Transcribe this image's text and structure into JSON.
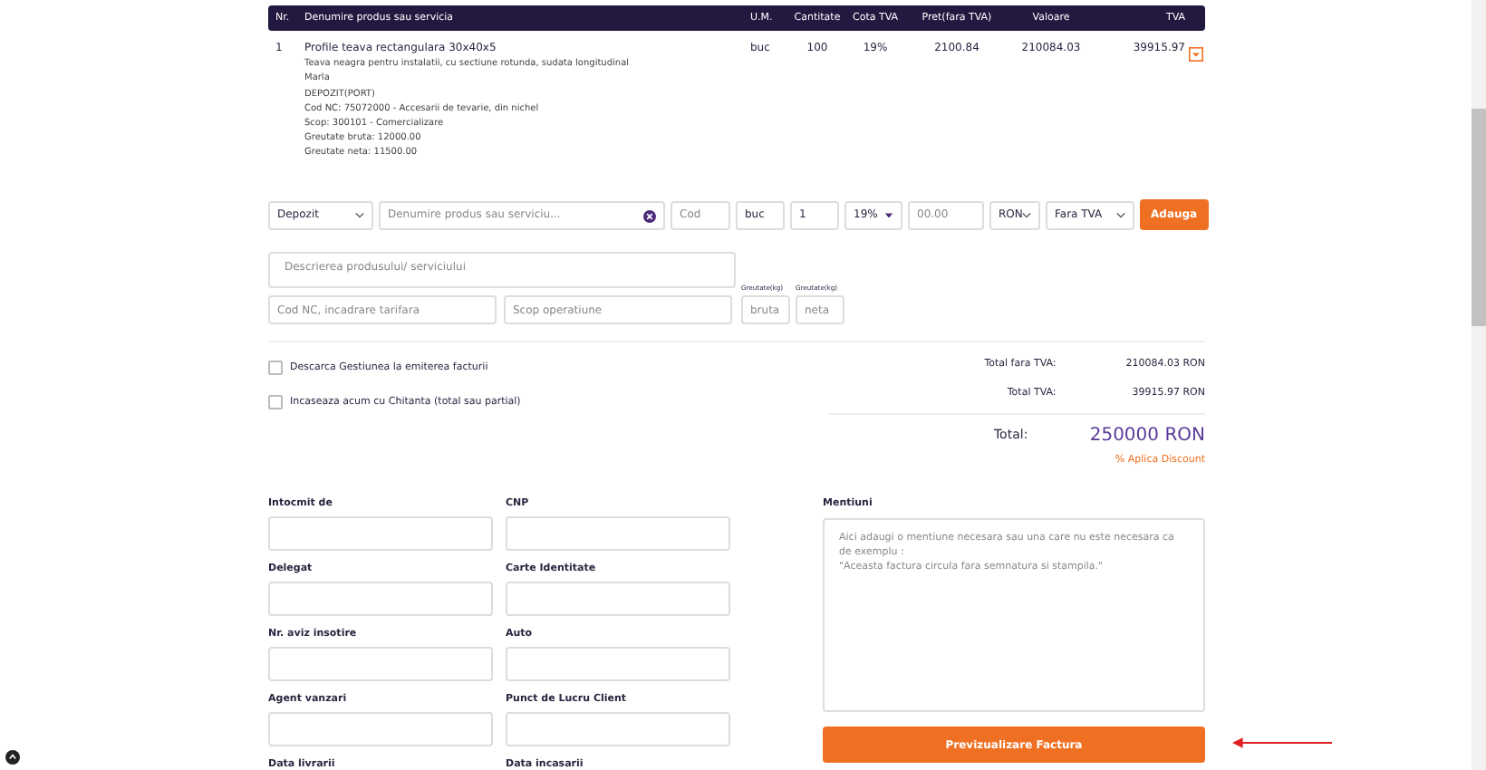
{
  "table": {
    "columns": [
      "Nr.",
      "Denumire produs sau servicia",
      "U.M.",
      "Cantitate",
      "Cota TVA",
      "Pret(fara TVA)",
      "Valoare",
      "TVA"
    ],
    "rows": [
      {
        "nr": "1",
        "name": "Profile teava rectangulara 30x40x5",
        "details": [
          "Teava neagra pentru instalatii, cu sectiune rotunda, sudata longitudinal",
          "Marla",
          "DEPOZIT(PORT)",
          "Cod NC: 75072000 - Accesarii de tevarie, din nichel",
          "Scop: 300101 - Comercializare",
          "Greutate bruta: 12000.00",
          "Greutate neta: 11500.00"
        ],
        "um": "buc",
        "qty": "100",
        "vat_rate": "19%",
        "price": "2100.84",
        "value": "210084.03",
        "vat": "39915.97"
      }
    ]
  },
  "entry_form": {
    "warehouse": "Depozit",
    "product_placeholder": "Denumire produs sau serviciu...",
    "code_placeholder": "Cod",
    "unit": "buc",
    "qty": "1",
    "vat_rate": "19%",
    "price_placeholder": "00.00",
    "currency": "RON",
    "vat_mode": "Fara TVA",
    "add_button": "Adauga",
    "description_placeholder": "Descrierea produsului/ serviciului",
    "nc_placeholder": "Cod NC, incadrare tarifara",
    "scope_placeholder": "Scop operatiune",
    "weights": [
      {
        "label": "Greutate(kg)",
        "placeholder": "bruta"
      },
      {
        "label": "Greutate(kg)",
        "placeholder": "neta"
      }
    ]
  },
  "options": [
    {
      "label": "Descarca Gestiunea la emiterea facturii",
      "checked": false
    },
    {
      "label": "Incaseaza acum cu Chitanta (total sau partial)",
      "checked": false
    }
  ],
  "totals": [
    {
      "label": "Total fara TVA:",
      "value": "210084.03 RON"
    },
    {
      "label": "Total TVA:",
      "value": "39915.97 RON"
    }
  ],
  "grand_total": {
    "label": "Total:",
    "value": "250000 RON"
  },
  "discount_link": "% Aplica Discount",
  "fields": [
    {
      "label": "Intocmit de"
    },
    {
      "label": "CNP"
    },
    {
      "label": "Delegat"
    },
    {
      "label": "Carte Identitate"
    },
    {
      "label": "Nr. aviz insotire"
    },
    {
      "label": "Auto"
    },
    {
      "label": "Agent vanzari"
    },
    {
      "label": "Punct de Lucru Client"
    },
    {
      "label": "Data livrarii"
    },
    {
      "label": "Data incasarii"
    }
  ],
  "mentions": {
    "label": "Mentiuni",
    "placeholder": "Aici adaugi o mentiune necesara sau una care nu este necesara ca de exemplu :\n\"Aceasta factura circula fara semnatura si stampila.\""
  },
  "preview_button": "Previzualizare Factura"
}
